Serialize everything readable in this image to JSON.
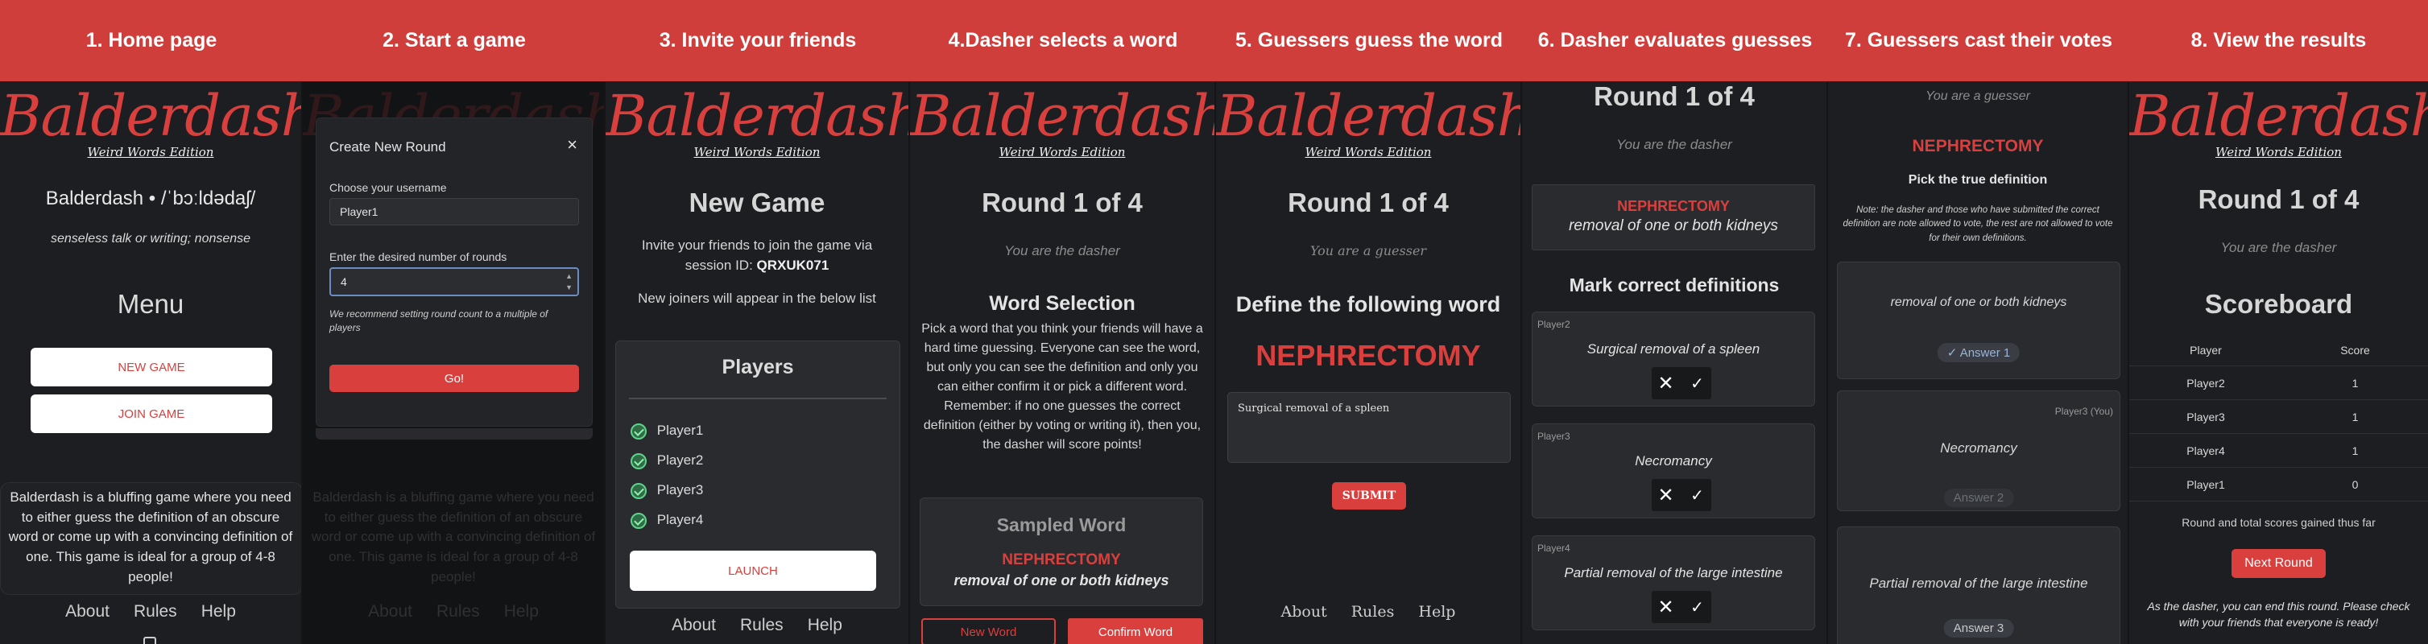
{
  "steps": [
    "1. Home page",
    "2. Start a game",
    "3. Invite your friends",
    "4.Dasher selects a word",
    "5. Guessers guess the word",
    "6. Dasher evaluates guesses",
    "7. Guessers cast their votes",
    "8. View the results"
  ],
  "logo": {
    "word": "Balderdash",
    "excl": "!",
    "sub": "Weird Words Edition"
  },
  "footer": {
    "about": "About",
    "rules": "Rules",
    "help": "Help"
  },
  "p1": {
    "headword": "Balderdash • /ˈbɔːldədaʃ/",
    "definition": "senseless talk or writing; nonsense",
    "menu": "Menu",
    "new_game": "NEW GAME",
    "join_game": "JOIN GAME",
    "description": "Balderdash is a bluffing game where you need to either guess the definition of an obscure word or come up with a convincing definition of one. This game is ideal for a group of 4-8 people!"
  },
  "p2": {
    "modal_title": "Create New Round",
    "close": "×",
    "username_label": "Choose your username",
    "username_value": "Player1",
    "rounds_label": "Enter the desired number of rounds",
    "rounds_value": "4",
    "hint": "We recommend setting round count to a multiple of players",
    "go": "Go!",
    "bg_description": "Balderdash is a bluffing game where you need to either guess the definition of an obscure word or come up with a convincing definition of one. This game is ideal for a group of 4-8 people!"
  },
  "p3": {
    "title": "New Game",
    "invite": "Invite your friends to join the game via session ID:",
    "session_id": "QRXUK071",
    "new_joiners": "New joiners will appear in the below list",
    "players_title": "Players",
    "players": [
      "Player1",
      "Player2",
      "Player3",
      "Player4"
    ],
    "launch": "LAUNCH"
  },
  "p4": {
    "round": "Round 1 of 4",
    "role": "You are the dasher",
    "section": "Word Selection",
    "instructions": "Pick a word that you think your friends will have a hard time guessing. Everyone can see the word, but only you can see the definition and only you can either confirm it or pick a different word. Remember: if no one guesses the correct definition (either by voting or writing it), then you, the dasher will score points!",
    "sampled_title": "Sampled Word",
    "word": "NEPHRECTOMY",
    "word_def": "removal of one or both kidneys",
    "new_word": "New Word",
    "confirm_word": "Confirm Word"
  },
  "p5": {
    "round": "Round 1 of 4",
    "role": "You are a guesser",
    "prompt": "Define the following word",
    "word": "NEPHRECTOMY",
    "guess": "Surgical removal of a spleen",
    "submit": "SUBMIT"
  },
  "p6": {
    "round": "Round 1 of 4",
    "role": "You are the dasher",
    "word": "NEPHRECTOMY",
    "word_def": "removal of one or both kidneys",
    "section": "Mark correct definitions",
    "guesses": [
      {
        "player": "Player2",
        "text": "Surgical removal of a spleen"
      },
      {
        "player": "Player3",
        "text": "Necromancy"
      },
      {
        "player": "Player4",
        "text": "Partial removal of the large intestine"
      }
    ]
  },
  "p7": {
    "role": "You are a guesser",
    "word": "NEPHRECTOMY",
    "section": "Pick the true definition",
    "note": "Note: the dasher and those who have submitted the correct definition are note allowed to vote, the rest are not allowed to vote for their own definitions.",
    "options": [
      {
        "text": "removal of one or both kidneys",
        "answer": "✓ Answer 1",
        "tag": ""
      },
      {
        "text": "Necromancy",
        "answer": "Answer 2",
        "tag": "Player3 (You)"
      },
      {
        "text": "Partial removal of the large intestine",
        "answer": "Answer 3",
        "tag": ""
      }
    ]
  },
  "p8": {
    "round": "Round 1 of 4",
    "role": "You are the dasher",
    "title": "Scoreboard",
    "col_player": "Player",
    "col_score": "Score",
    "rows": [
      {
        "player": "Player2",
        "score": "1"
      },
      {
        "player": "Player3",
        "score": "1"
      },
      {
        "player": "Player4",
        "score": "1"
      },
      {
        "player": "Player1",
        "score": "0"
      }
    ],
    "caption": "Round and total scores gained thus far",
    "next_round": "Next Round",
    "dasher_note": "As the dasher, you can end this round. Please check with your friends that everyone is ready!"
  },
  "colors": {
    "brand_red": "#d9403d",
    "header_red": "#cf3e3b",
    "background": "#1d1e21",
    "card": "#2a2b2e"
  }
}
